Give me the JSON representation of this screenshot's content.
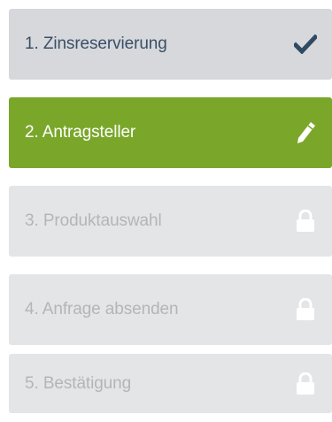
{
  "steps": [
    {
      "label": "1. Zinsreservierung",
      "state": "done",
      "icon": "checkmark-icon"
    },
    {
      "label": "2. Antragsteller",
      "state": "active",
      "icon": "pencil-icon"
    },
    {
      "label": "3. Produktauswahl",
      "state": "locked",
      "icon": "lock-icon"
    },
    {
      "label": "4. Anfrage absenden",
      "state": "locked",
      "icon": "lock-icon"
    },
    {
      "label": "5. Bestätigung",
      "state": "locked",
      "icon": "lock-icon"
    }
  ],
  "colors": {
    "done_bg": "#d6d8dc",
    "done_text": "#3a4f66",
    "active_bg": "#7aa72a",
    "active_text": "#ffffff",
    "locked_bg": "#e4e5e7",
    "locked_text": "#b3b5b9"
  }
}
